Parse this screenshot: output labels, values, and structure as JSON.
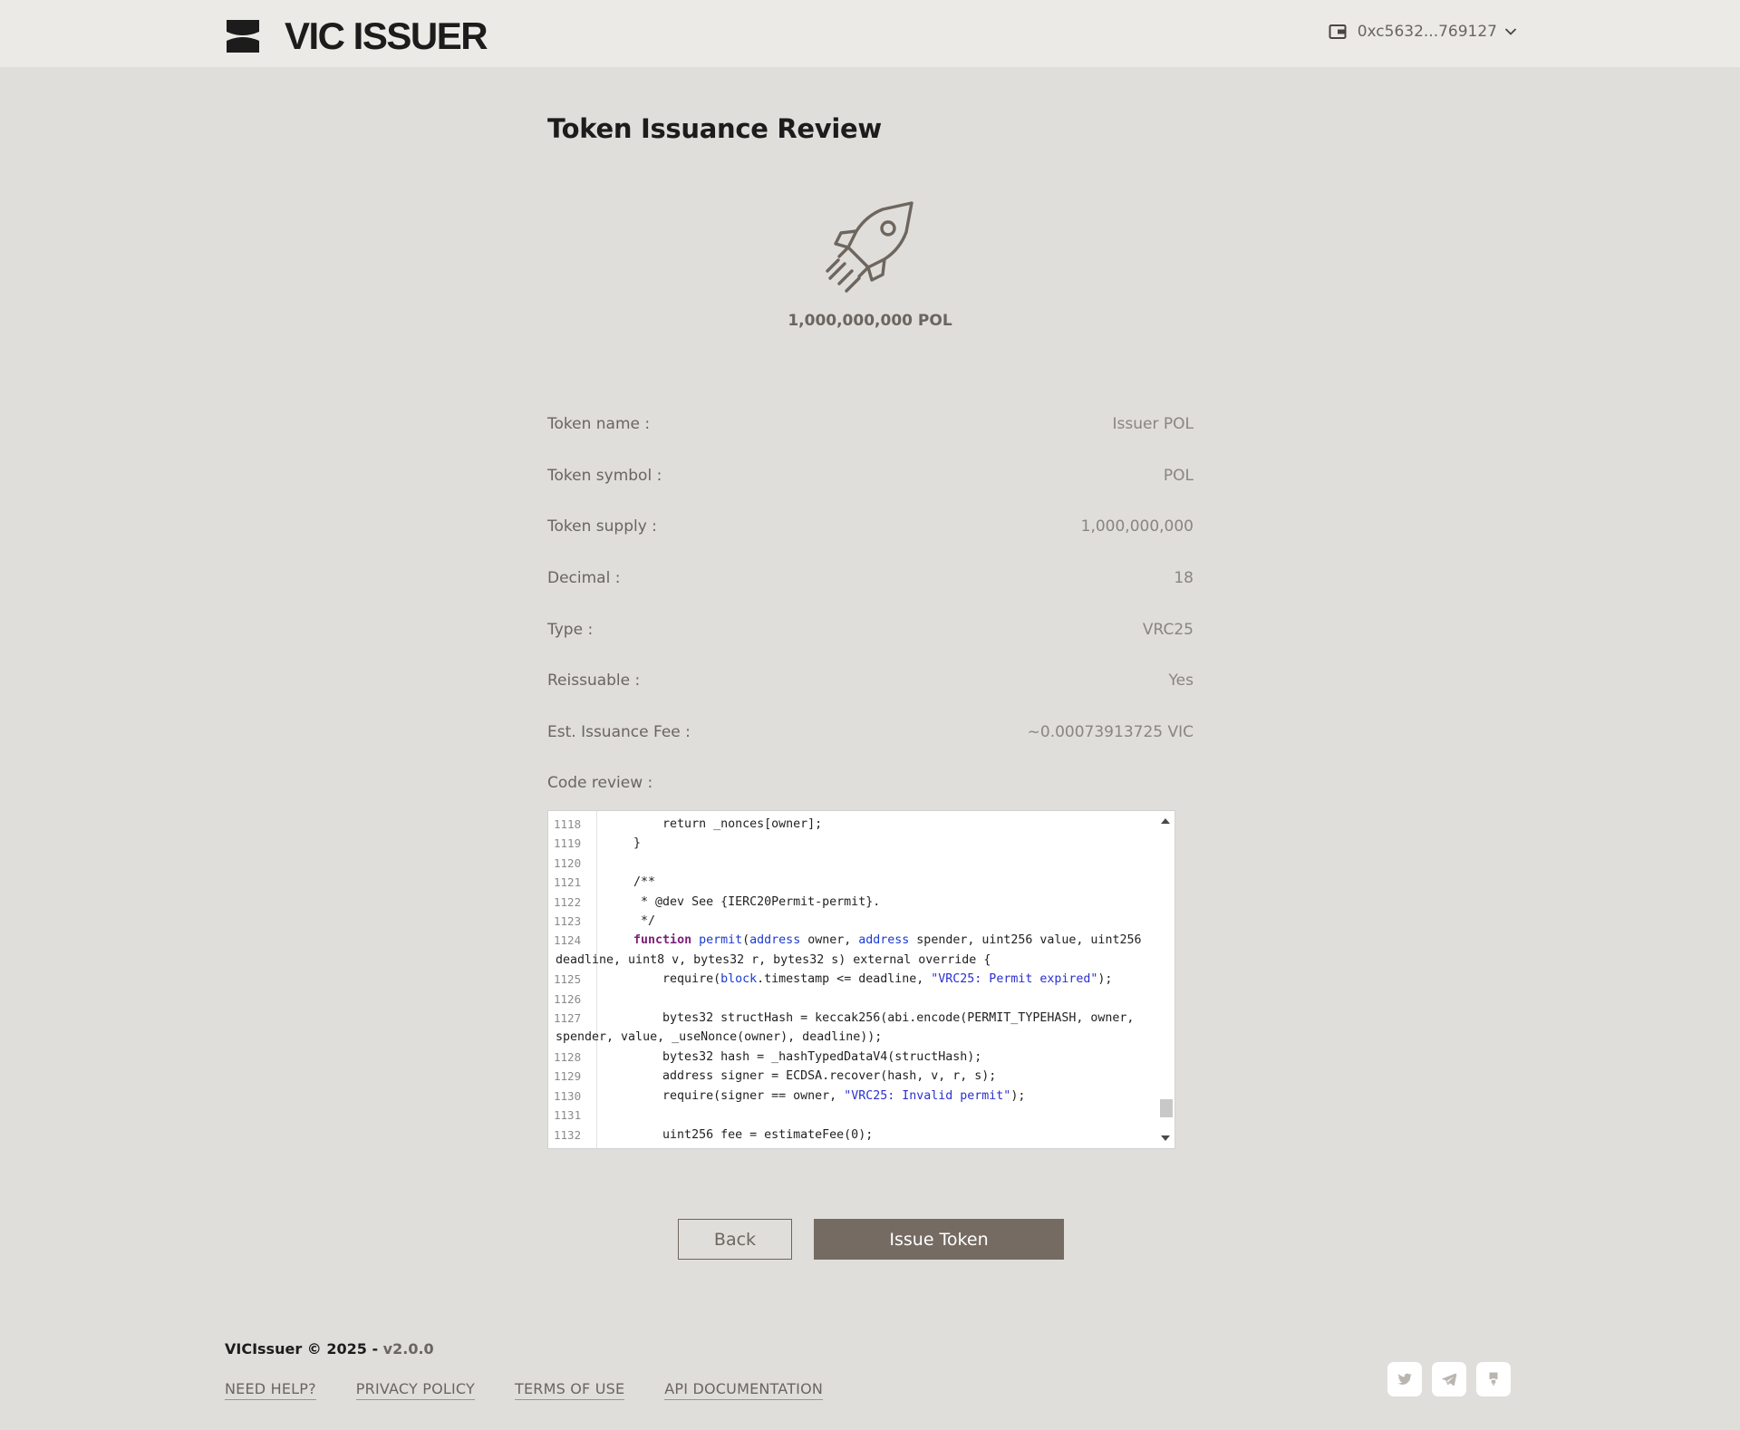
{
  "header": {
    "brand": "VIC ISSUER",
    "wallet_address": "0xc5632...769127"
  },
  "page": {
    "title": "Token Issuance Review",
    "supply_display": "1,000,000,000 POL"
  },
  "details": [
    {
      "label": "Token name :",
      "value": "Issuer POL"
    },
    {
      "label": "Token symbol :",
      "value": "POL"
    },
    {
      "label": "Token supply :",
      "value": "1,000,000,000"
    },
    {
      "label": "Decimal :",
      "value": "18"
    },
    {
      "label": "Type :",
      "value": "VRC25"
    },
    {
      "label": "Reissuable :",
      "value": "Yes"
    },
    {
      "label": "Est. Issuance Fee :",
      "value": "~0.00073913725 VIC"
    },
    {
      "label": "Code review :",
      "value": ""
    }
  ],
  "code": {
    "line_numbers": [
      "1118",
      "1119",
      "1120",
      "1121",
      "1122",
      "1123",
      "1124",
      "",
      "1125",
      "1126",
      "1127",
      "",
      "1128",
      "1129",
      "1130",
      "1131",
      "1132"
    ]
  },
  "buttons": {
    "back": "Back",
    "issue": "Issue Token"
  },
  "footer": {
    "brand": "VICIssuer © 2025 - ",
    "version": "v2.0.0",
    "links": [
      "NEED HELP?",
      "PRIVACY POLICY",
      "TERMS OF USE",
      "API DOCUMENTATION"
    ]
  },
  "icons": {
    "logo": "vic-logo-icon",
    "wallet": "wallet-icon",
    "dropdown": "chevron-down-icon",
    "hero": "rocket-icon",
    "social": [
      "twitter-icon",
      "telegram-icon",
      "github-icon"
    ]
  },
  "colors": {
    "background": "#dfdeda",
    "header": "#ebeae6",
    "primary_button": "#756b62",
    "text": "#6b6560"
  }
}
